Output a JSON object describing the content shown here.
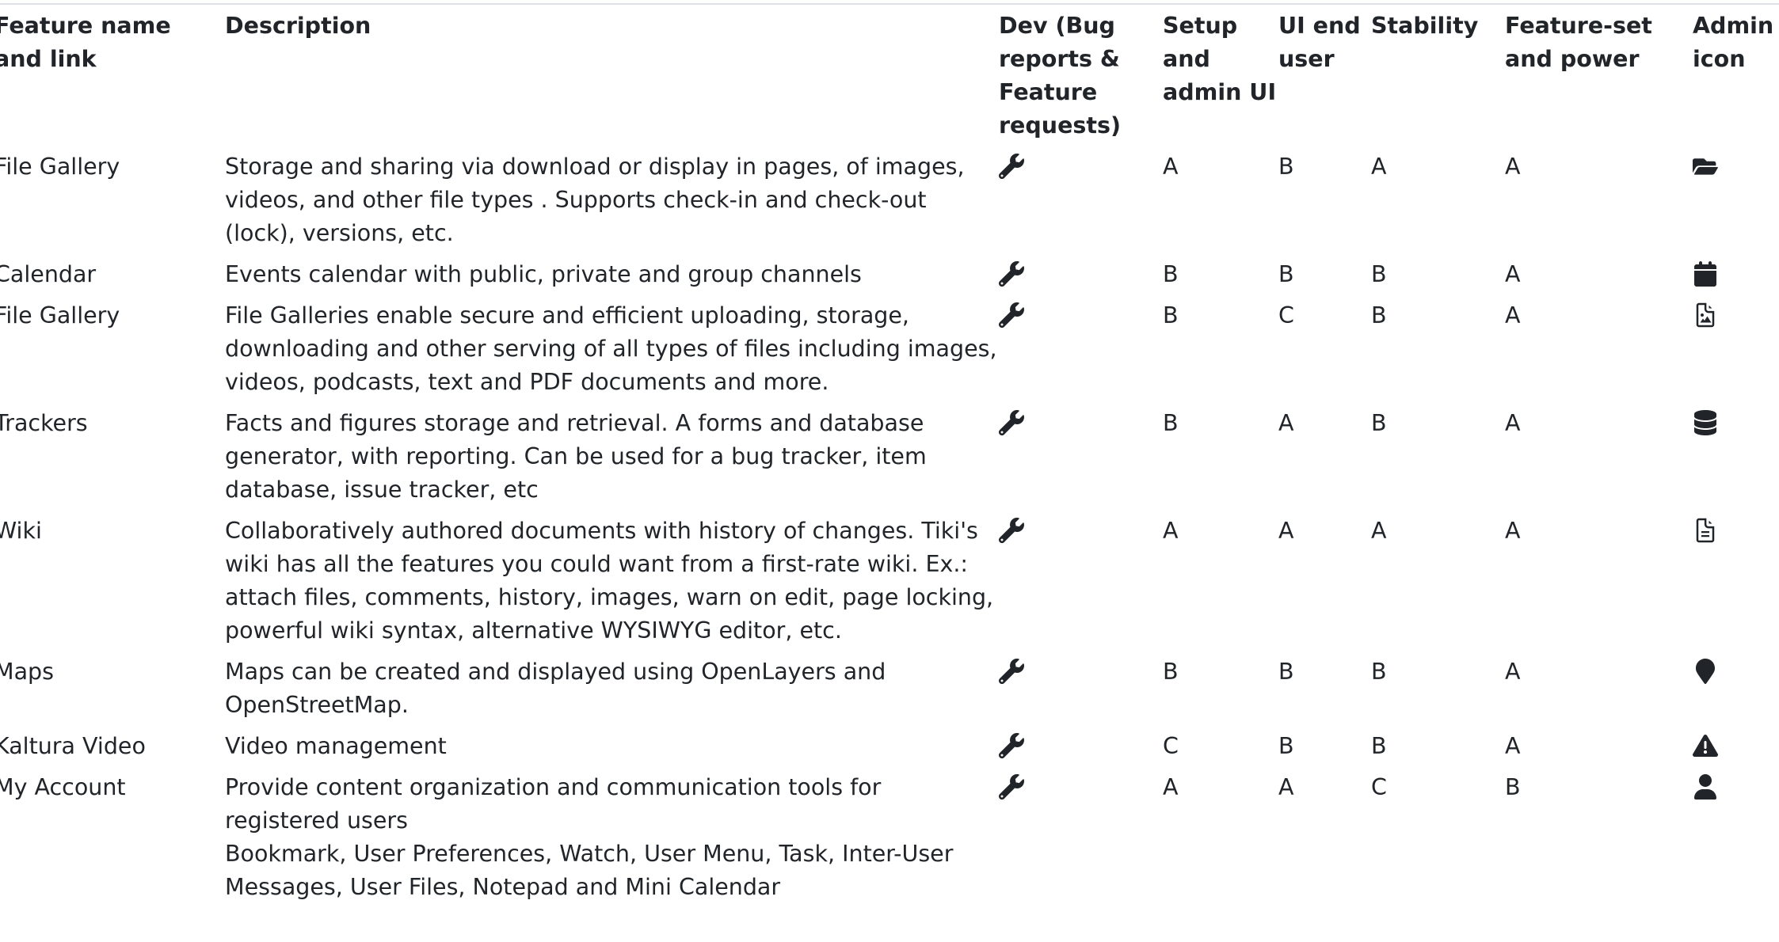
{
  "header": {
    "name": "Feature name and link",
    "description": "Description",
    "dev": "Dev (Bug reports & Feature requests)",
    "setup": "Setup and admin UI",
    "ui": "UI end user",
    "stability": "Stability",
    "featureset": "Feature-set and power",
    "admin": "Admin icon"
  },
  "rows": [
    {
      "name": "File Gallery",
      "description": "Storage and sharing via download or display in pages, of images, videos, and other file types . Supports check-in and check-out (lock), versions, etc.",
      "dev_icon": "wrench-icon",
      "setup": "A",
      "ui": "B",
      "stability": "A",
      "featureset": "A",
      "admin_icon": "folder-open-icon"
    },
    {
      "name": "Calendar",
      "description": "Events calendar with public, private and group channels",
      "dev_icon": "wrench-icon",
      "setup": "B",
      "ui": "B",
      "stability": "B",
      "featureset": "A",
      "admin_icon": "calendar-icon"
    },
    {
      "name": "File Gallery",
      "description": "File Galleries enable secure and efficient uploading, storage, downloading and other serving of all types of files including images, videos, podcasts, text and PDF documents and more.",
      "dev_icon": "wrench-icon",
      "setup": "B",
      "ui": "C",
      "stability": "B",
      "featureset": "A",
      "admin_icon": "file-image-icon"
    },
    {
      "name": "Trackers",
      "description": "Facts and figures storage and retrieval. A forms and database generator, with reporting. Can be used for a bug tracker, item database, issue tracker, etc",
      "dev_icon": "wrench-icon",
      "setup": "B",
      "ui": "A",
      "stability": "B",
      "featureset": "A",
      "admin_icon": "database-icon"
    },
    {
      "name": "Wiki",
      "description": "Collaboratively authored documents with history of changes. Tiki's wiki has all the features you could want from a first-rate wiki. Ex.: attach files, comments, history, images, warn on edit, page locking, powerful wiki syntax, alternative WYSIWYG editor, etc.",
      "dev_icon": "wrench-icon",
      "setup": "A",
      "ui": "A",
      "stability": "A",
      "featureset": "A",
      "admin_icon": "file-text-icon"
    },
    {
      "name": "Maps",
      "description": "Maps can be created and displayed using OpenLayers and OpenStreetMap.",
      "dev_icon": "wrench-icon",
      "setup": "B",
      "ui": "B",
      "stability": "B",
      "featureset": "A",
      "admin_icon": "map-marker-icon"
    },
    {
      "name": "Kaltura Video",
      "description": "Video management",
      "dev_icon": "wrench-icon",
      "setup": "C",
      "ui": "B",
      "stability": "B",
      "featureset": "A",
      "admin_icon": "warning-icon"
    },
    {
      "name": "My Account",
      "description": "Provide content organization and communication tools for registered users",
      "description_extra": "Bookmark, User Preferences, Watch, User Menu, Task, Inter-User Messages, User Files, Notepad and Mini Calendar",
      "dev_icon": "wrench-icon",
      "setup": "A",
      "ui": "A",
      "stability": "C",
      "featureset": "B",
      "admin_icon": "user-icon"
    }
  ]
}
